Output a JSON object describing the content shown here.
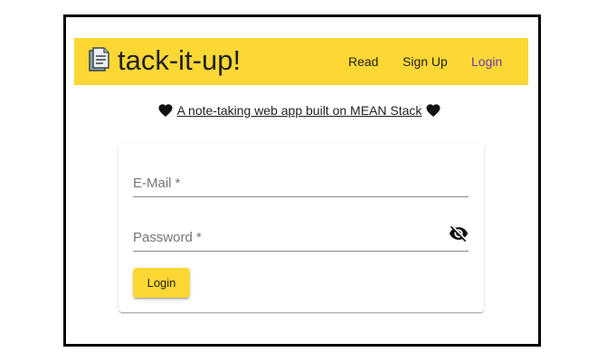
{
  "header": {
    "brand": "tack-it-up!",
    "brand_icon": "document-icon",
    "bg_color": "#fdd835",
    "nav": [
      {
        "label": "Read"
      },
      {
        "label": "Sign Up"
      },
      {
        "label": "Login"
      }
    ],
    "active_color": "#673ab7"
  },
  "tagline": {
    "text": "A note-taking web app built on MEAN Stack",
    "icon": "heart-icon"
  },
  "login_form": {
    "email_placeholder": "E-Mail *",
    "password_placeholder": "Password *",
    "visibility_icon": "visibility-off-icon",
    "submit_label": "Login"
  }
}
